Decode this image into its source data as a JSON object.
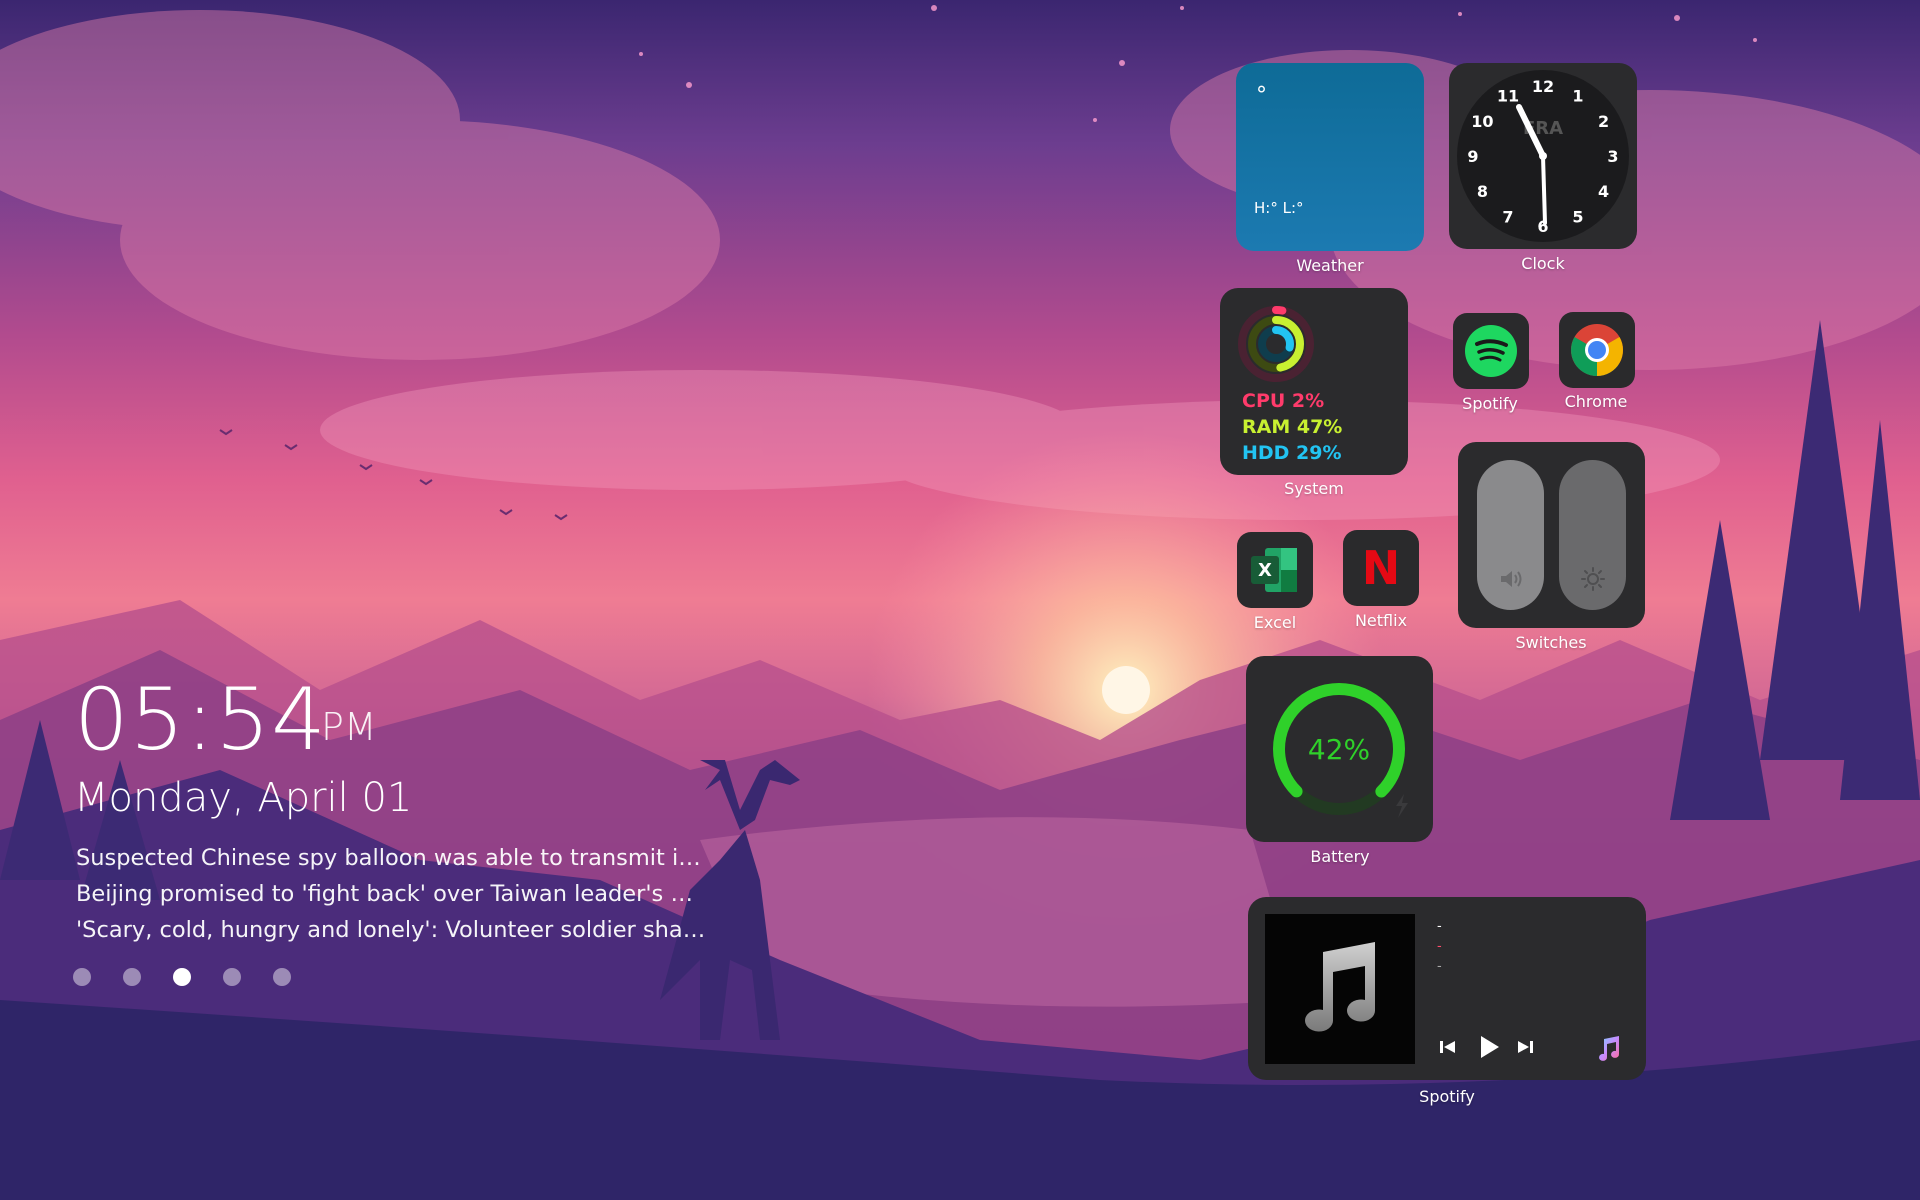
{
  "clock": {
    "time": "05:54",
    "ampm": "PM",
    "date": "Monday, April 01"
  },
  "news": [
    "Suspected Chinese spy balloon was able to transmit informa...",
    "Beijing promised to 'fight back' over Taiwan leader's US visit...",
    "'Scary, cold, hungry and lonely': Volunteer soldier shares exp..."
  ],
  "pager": {
    "count": 5,
    "active_index": 2
  },
  "widgets": {
    "weather": {
      "label": "Weather",
      "temp": "°",
      "hilo": "H:° L:°"
    },
    "clock": {
      "label": "Clock",
      "brand": "FRA",
      "numbers": [
        "12",
        "1",
        "2",
        "3",
        "4",
        "5",
        "6",
        "7",
        "8",
        "9",
        "10",
        "11"
      ]
    },
    "system": {
      "label": "System",
      "cpu": "CPU 2%",
      "ram": "RAM 47%",
      "hdd": "HDD 29%",
      "cpu_color": "#ff3b6b",
      "ram_color": "#c8f031",
      "hdd_color": "#22c4f2",
      "cpu_value": 0.02,
      "ram_value": 0.47,
      "hdd_value": 0.29
    },
    "spotify_app": {
      "label": "Spotify"
    },
    "chrome_app": {
      "label": "Chrome"
    },
    "excel_app": {
      "label": "Excel",
      "glyph": "X"
    },
    "netflix_app": {
      "label": "Netflix",
      "glyph": "N"
    },
    "switches": {
      "label": "Switches",
      "volume_icon": "speaker-icon",
      "brightness_icon": "sun-icon"
    },
    "battery": {
      "label": "Battery",
      "percent": "42%",
      "level": 0.42,
      "color": "#2fd12a"
    },
    "spotify_player": {
      "label": "Spotify",
      "track": "-",
      "artist": "-",
      "album": "-",
      "artwork_icon": "music-note-icon"
    }
  }
}
